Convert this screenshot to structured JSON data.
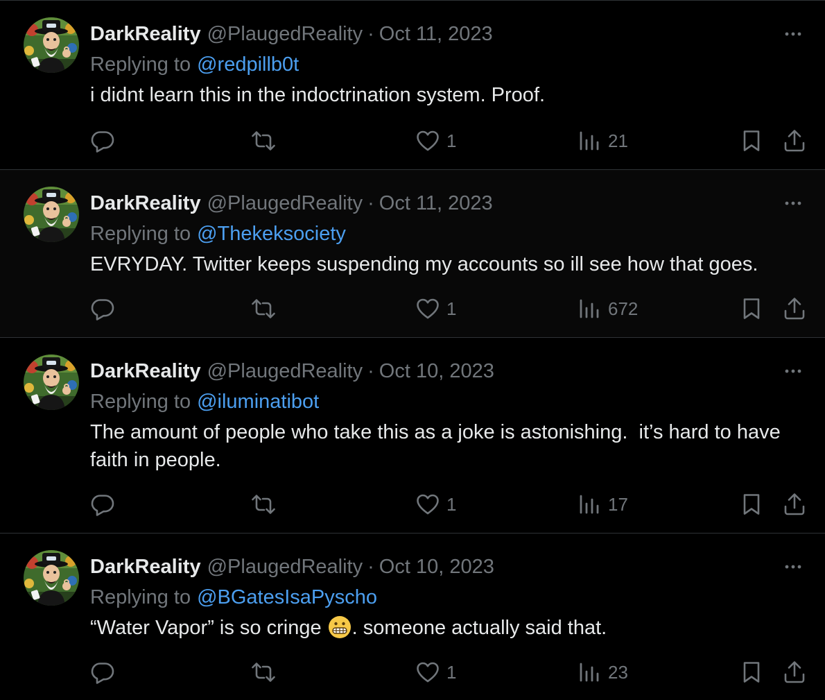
{
  "timeline": {
    "tweets": [
      {
        "display_name": "DarkReality",
        "handle": "@PlaugedReality",
        "separator": "·",
        "date": "Oct 11, 2023",
        "reply_prefix": "Replying to",
        "reply_to": "@redpillb0t",
        "text": "i didnt learn this in the indoctrination system. Proof.",
        "likes": "1",
        "views": "21",
        "more_icon": "more-dots-icon",
        "reply_icon": "reply-bubble-icon",
        "retweet_icon": "retweet-icon",
        "like_icon": "heart-icon",
        "views_icon": "analytics-bars-icon",
        "bookmark_icon": "bookmark-icon",
        "share_icon": "share-upload-icon"
      },
      {
        "display_name": "DarkReality",
        "handle": "@PlaugedReality",
        "separator": "·",
        "date": "Oct 11, 2023",
        "reply_prefix": "Replying to",
        "reply_to": "@Thekeksociety",
        "text": "EVRYDAY. Twitter keeps suspending my accounts so ill see how that goes.",
        "likes": "1",
        "views": "672"
      },
      {
        "display_name": "DarkReality",
        "handle": "@PlaugedReality",
        "separator": "·",
        "date": "Oct 10, 2023",
        "reply_prefix": "Replying to",
        "reply_to": "@iluminatibot",
        "text": "The amount of people who take this as a joke is astonishing.  it’s hard to have faith in people.",
        "likes": "1",
        "views": "17"
      },
      {
        "display_name": "DarkReality",
        "handle": "@PlaugedReality",
        "separator": "·",
        "date": "Oct 10, 2023",
        "reply_prefix": "Replying to",
        "reply_to": "@BGatesIsaPyscho",
        "text_before_emoji": "“Water Vapor” is so cringe",
        "emoji": "grimacing-face-emoji",
        "text_after_emoji": ". someone actually said that.",
        "likes": "1",
        "views": "23"
      }
    ]
  },
  "colors": {
    "background": "#000000",
    "hover_background": "#080808",
    "primary_text": "#e7e9ea",
    "secondary_text": "#71767b",
    "mention_link": "#4c9ff0",
    "divider": "#2f3336"
  }
}
